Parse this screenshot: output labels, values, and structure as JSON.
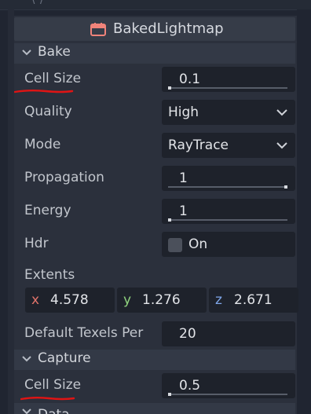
{
  "header": {
    "title": "BakedLightmap"
  },
  "sections": {
    "bake": "Bake",
    "capture": "Capture",
    "data": "Data"
  },
  "bake": {
    "cell_size": {
      "label": "Cell Size",
      "value": "0.1"
    },
    "quality": {
      "label": "Quality",
      "value": "High"
    },
    "mode": {
      "label": "Mode",
      "value": "RayTrace"
    },
    "propagation": {
      "label": "Propagation",
      "value": "1"
    },
    "energy": {
      "label": "Energy",
      "value": "1"
    },
    "hdr": {
      "label": "Hdr",
      "value": "On",
      "checked": false
    },
    "extents": {
      "label": "Extents",
      "x_label": "x",
      "x": "4.578",
      "y_label": "y",
      "y": "1.276",
      "z_label": "z",
      "z": "2.671"
    },
    "default_texels": {
      "label": "Default Texels Per",
      "value": "20"
    }
  },
  "capture": {
    "cell_size": {
      "label": "Cell Size",
      "value": "0.5"
    }
  },
  "colors": {
    "axis_x": "#e0736a",
    "axis_y": "#8fd27e",
    "axis_z": "#7fa6e8",
    "annotation": "#e01414",
    "node_icon": "#f0837a"
  }
}
